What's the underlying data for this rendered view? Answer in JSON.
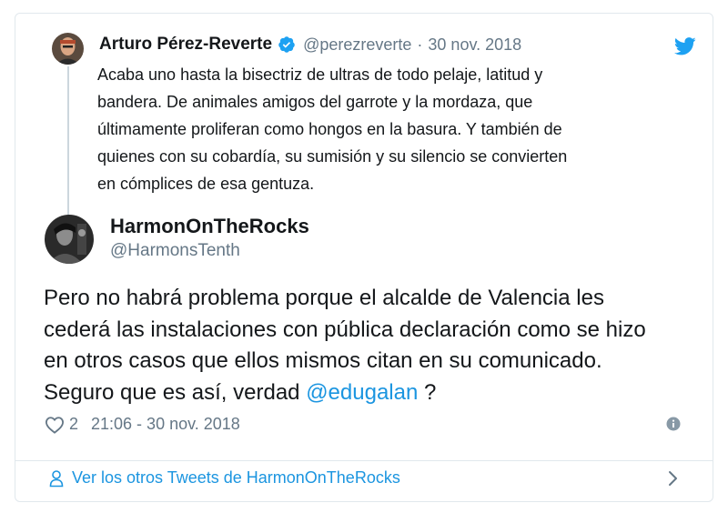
{
  "quoted_tweet": {
    "author_name": "Arturo Pérez-Reverte",
    "handle": "@perezreverte",
    "separator": "·",
    "date": "30 nov. 2018",
    "lines": [
      "Acaba uno hasta la bisectriz de ultras de todo pelaje, latitud y",
      "bandera. De animales amigos del garrote y la mordaza, que",
      "últimamente proliferan como hongos en la basura. Y también de",
      "quienes con su cobardía, su sumisión y su silencio se convierten",
      "en cómplices de esa gentuza."
    ]
  },
  "main_tweet": {
    "author_name": "HarmonOnTheRocks",
    "handle": "@HarmonsTenth",
    "lines": [
      "Pero no habrá problema porque el alcalde de Valencia les",
      "cederá las instalaciones con pública declaración como se hizo",
      "en otros casos que ellos mismos citan en su comunicado."
    ],
    "last_line_prefix": "Seguro que es así, verdad ",
    "mention": "@edugalan",
    "last_line_suffix": " ?"
  },
  "footer": {
    "likes": "2",
    "timestamp": "21:06 - 30 nov. 2018",
    "more_tweets_label": "Ver los otros Tweets de HarmonOnTheRocks"
  },
  "colors": {
    "twitter_blue": "#1da1f2",
    "link_blue": "#1b95e0",
    "muted_gray": "#657786",
    "border": "#e1e8ed"
  }
}
